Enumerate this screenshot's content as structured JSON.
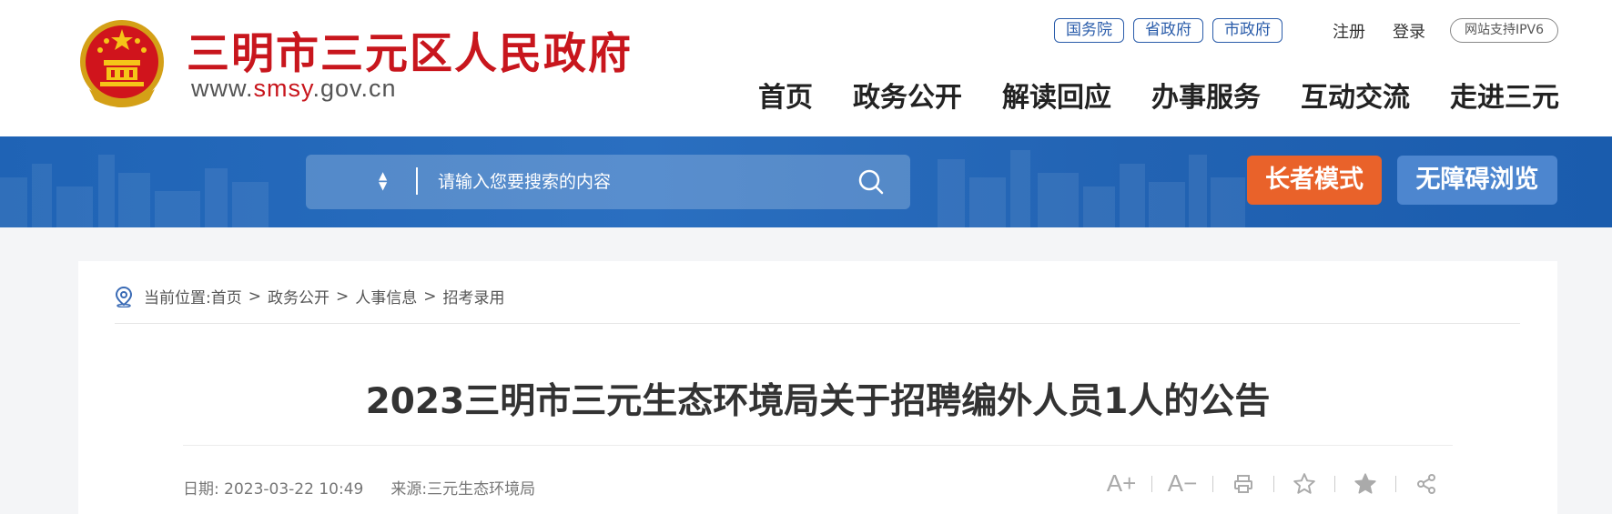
{
  "header": {
    "site_title": "三明市三元区人民政府",
    "domain_prefix": "www.",
    "domain_highlight": "smsy",
    "domain_suffix": ".gov.cn",
    "top_links": [
      "国务院",
      "省政府",
      "市政府"
    ],
    "user_links": [
      "注册",
      "登录"
    ],
    "ipv6_badge": "网站支持IPV6",
    "nav": [
      "首页",
      "政务公开",
      "解读回应",
      "办事服务",
      "互动交流",
      "走进三元"
    ]
  },
  "banner": {
    "search_placeholder": "请输入您要搜索的内容",
    "elder_mode_label": "长者模式",
    "accessibility_label": "无障碍浏览"
  },
  "breadcrumb": {
    "prefix": "当前位置:",
    "items": [
      "首页",
      "政务公开",
      "人事信息",
      "招考录用"
    ]
  },
  "article": {
    "title": "2023三明市三元生态环境局关于招聘编外人员1人的公告",
    "date_label": "日期:",
    "date_value": "2023-03-22 10:49",
    "source_label": "来源:",
    "source_value": "三元生态环境局"
  },
  "tools": {
    "font_increase": "A+",
    "font_decrease": "A−"
  },
  "colors": {
    "brand_red": "#c8161d",
    "nav_blue": "#2a5caa",
    "banner_blue": "#2263b3",
    "elder_orange": "#e9622a",
    "access_blue": "#4d86cf"
  }
}
